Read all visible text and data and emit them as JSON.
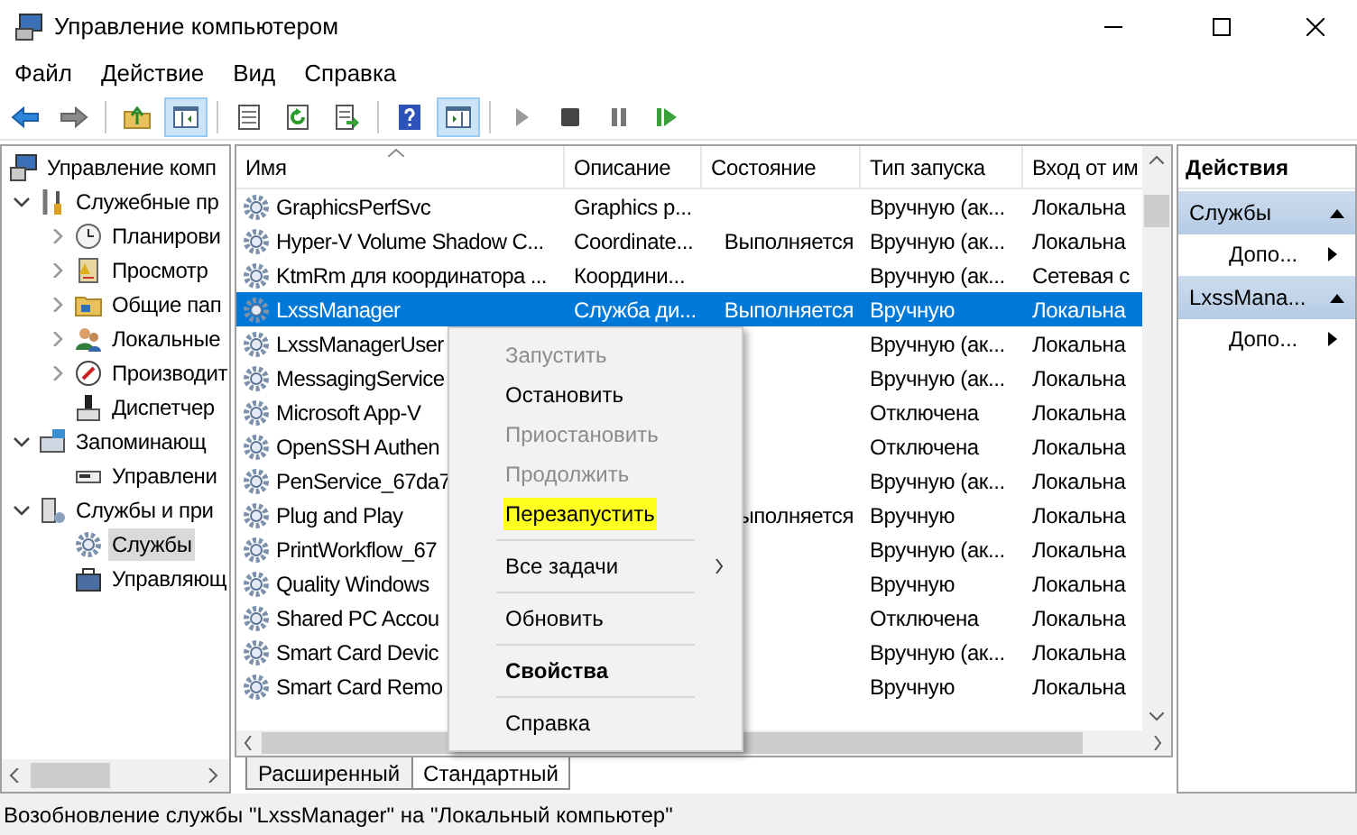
{
  "window": {
    "title": "Управление компьютером"
  },
  "menu": [
    "Файл",
    "Действие",
    "Вид",
    "Справка"
  ],
  "toolbar": [
    {
      "pressed": false
    },
    {
      "pressed": false
    },
    {
      "pressed": false
    },
    {
      "pressed": true
    },
    {
      "pressed": false
    },
    {
      "pressed": false
    },
    {
      "pressed": false
    },
    {
      "pressed": false
    },
    {
      "pressed": true
    },
    {
      "pressed": false
    },
    {
      "pressed": false
    },
    {
      "pressed": false
    },
    {
      "pressed": false
    }
  ],
  "tree": [
    {
      "label": "Управление комп",
      "selected": false,
      "children": [
        {
          "label": "Служебные пр",
          "expanded": true,
          "selected": false,
          "children": [
            {
              "label": "Планирови",
              "expanded": false,
              "selected": false
            },
            {
              "label": "Просмотр",
              "expanded": false,
              "selected": false
            },
            {
              "label": "Общие пап",
              "expanded": false,
              "selected": false
            },
            {
              "label": "Локальные",
              "expanded": false,
              "selected": false
            },
            {
              "label": "Производит",
              "expanded": false,
              "selected": false
            },
            {
              "label": "Диспетчер",
              "selected": false
            }
          ]
        },
        {
          "label": "Запоминающ",
          "expanded": true,
          "selected": false,
          "children": [
            {
              "label": "Управлени",
              "selected": false
            }
          ]
        },
        {
          "label": "Службы и при",
          "expanded": true,
          "selected": false,
          "children": [
            {
              "label": "Службы",
              "selected": true
            },
            {
              "label": "Управляющ",
              "selected": false
            }
          ]
        }
      ]
    }
  ],
  "table": {
    "columns": [
      "Имя",
      "Описание",
      "Состояние",
      "Тип запуска",
      "Вход от им"
    ],
    "rows": [
      {
        "name": "GraphicsPerfSvc",
        "description": "Graphics p...",
        "startup": "Вручную (ак...",
        "logon": "Локальна",
        "selected": false
      },
      {
        "name": "Hyper-V Volume Shadow C...",
        "description": "Coordinate...",
        "status": "Выполняется",
        "startup": "Вручную (ак...",
        "logon": "Локальна",
        "selected": false
      },
      {
        "name": "KtmRm для координатора ...",
        "description": "Координи...",
        "startup": "Вручную (ак...",
        "logon": "Сетевая с",
        "selected": false
      },
      {
        "name": "LxssManager",
        "description": "Служба ди...",
        "status": "Выполняется",
        "startup": "Вручную",
        "logon": "Локальна",
        "selected": true
      },
      {
        "name": "LxssManagerUser",
        "startup": "Вручную (ак...",
        "logon": "Локальна",
        "selected": false
      },
      {
        "name": "MessagingService",
        "startup": "Вручную (ак...",
        "logon": "Локальна",
        "selected": false
      },
      {
        "name": "Microsoft App-V",
        "startup": "Отключена",
        "logon": "Локальна",
        "selected": false
      },
      {
        "name": "OpenSSH Authen",
        "startup": "Отключена",
        "logon": "Локальна",
        "selected": false
      },
      {
        "name": "PenService_67da7",
        "startup": "Вручную (ак...",
        "logon": "Локальна",
        "selected": false
      },
      {
        "name": "Plug and Play",
        "status": "ыполняется",
        "startup": "Вручную",
        "logon": "Локальна",
        "selected": false
      },
      {
        "name": "PrintWorkflow_67",
        "startup": "Вручную (ак...",
        "logon": "Локальна",
        "selected": false
      },
      {
        "name": "Quality Windows",
        "startup": "Вручную",
        "logon": "Локальна",
        "selected": false
      },
      {
        "name": "Shared PC Accou",
        "startup": "Отключена",
        "logon": "Локальна",
        "selected": false
      },
      {
        "name": "Smart Card Devic",
        "startup": "Вручную (ак...",
        "logon": "Локальна",
        "selected": false
      },
      {
        "name": "Smart Card Remo",
        "startup": "Вручную",
        "logon": "Локальна",
        "selected": false
      }
    ]
  },
  "context_menu": [
    {
      "kind": "item",
      "label": "Запустить",
      "disabled": true,
      "highlighted": false
    },
    {
      "kind": "item",
      "label": "Остановить",
      "disabled": false,
      "highlighted": false
    },
    {
      "kind": "item",
      "label": "Приостановить",
      "disabled": true,
      "highlighted": false
    },
    {
      "kind": "item",
      "label": "Продолжить",
      "disabled": true,
      "highlighted": false
    },
    {
      "kind": "item",
      "label": "Перезапустить",
      "disabled": false,
      "highlighted": true
    },
    {
      "kind": "separator"
    },
    {
      "kind": "submenu",
      "label": "Все задачи",
      "disabled": false,
      "highlighted": false
    },
    {
      "kind": "separator"
    },
    {
      "kind": "item",
      "label": "Обновить",
      "disabled": false,
      "highlighted": false
    },
    {
      "kind": "separator"
    },
    {
      "kind": "default",
      "label": "Свойства",
      "disabled": false,
      "highlighted": false
    },
    {
      "kind": "separator"
    },
    {
      "kind": "item",
      "label": "Справка",
      "disabled": false,
      "highlighted": false
    }
  ],
  "view_tabs": [
    {
      "label": "Расширенный",
      "selected": false
    },
    {
      "label": "Стандартный",
      "selected": true
    }
  ],
  "actions": {
    "title": "Действия",
    "sections": [
      {
        "title": "Службы",
        "expanded": true,
        "items": [
          "Допо..."
        ]
      },
      {
        "title": "LxssMana...",
        "expanded": true,
        "items": [
          "Допо..."
        ]
      }
    ]
  },
  "status_bar": "Возобновление службы \"LxssManager\" на \"Локальный компьютер\""
}
